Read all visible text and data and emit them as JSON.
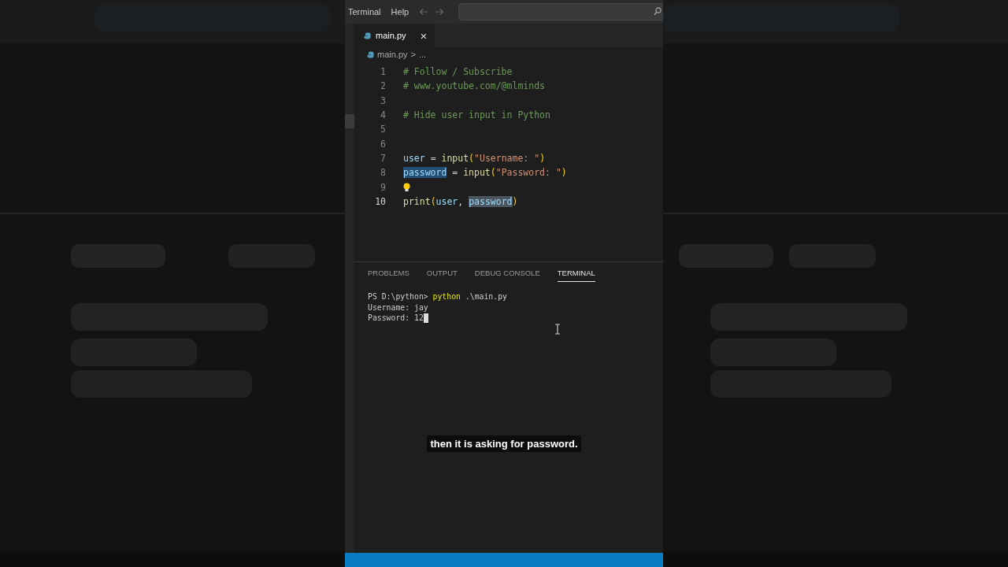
{
  "menu": [
    {
      "label": "Terminal"
    },
    {
      "label": "Help"
    }
  ],
  "editor_tabs": [
    {
      "label": "main.py",
      "selected": true,
      "close": "×"
    }
  ],
  "breadcrumb": {
    "file": "main.py",
    "separator": ">",
    "rest": "..."
  },
  "code_lines": [
    {
      "number": "1",
      "current": false,
      "tokens": [
        {
          "text": "# Follow / Subscribe",
          "kind": "comment"
        }
      ]
    },
    {
      "number": "2",
      "current": false,
      "tokens": [
        {
          "text": "# www.youtube.com/@mlminds",
          "kind": "comment"
        }
      ]
    },
    {
      "number": "3",
      "current": false
    },
    {
      "number": "4",
      "current": false,
      "tokens": [
        {
          "text": "# Hide user input in Python",
          "kind": "comment"
        }
      ]
    },
    {
      "number": "5",
      "current": false
    },
    {
      "number": "6",
      "current": false
    },
    {
      "number": "7",
      "current": false,
      "tokens": [
        {
          "text": "user",
          "kind": "var"
        },
        {
          "text": " = ",
          "kind": "plain"
        },
        {
          "text": "input",
          "kind": "func"
        },
        {
          "text": "(",
          "kind": "paren"
        },
        {
          "text": "\"Username: \"",
          "kind": "string"
        },
        {
          "text": ")",
          "kind": "paren"
        }
      ]
    },
    {
      "number": "8",
      "current": false,
      "tokens": [
        {
          "text": "password",
          "kind": "var",
          "selected": true
        },
        {
          "text": " = ",
          "kind": "plain"
        },
        {
          "text": "input",
          "kind": "func"
        },
        {
          "text": "(",
          "kind": "paren"
        },
        {
          "text": "\"Password: \"",
          "kind": "string"
        },
        {
          "text": ")",
          "kind": "paren"
        }
      ]
    },
    {
      "number": "9",
      "current": false,
      "lightbulb": true
    },
    {
      "number": "10",
      "current": true,
      "tokens": [
        {
          "text": "print",
          "kind": "func"
        },
        {
          "text": "(",
          "kind": "paren"
        },
        {
          "text": "user",
          "kind": "var"
        },
        {
          "text": ", ",
          "kind": "plain"
        },
        {
          "text": "password",
          "kind": "var",
          "match_highlighted": true
        },
        {
          "text": ")",
          "kind": "paren"
        }
      ]
    }
  ],
  "panel_tabs": [
    {
      "label": "PROBLEMS",
      "selected": false
    },
    {
      "label": "OUTPUT",
      "selected": false
    },
    {
      "label": "DEBUG CONSOLE",
      "selected": false
    },
    {
      "label": "TERMINAL",
      "selected": true
    }
  ],
  "terminal_lines": [
    {
      "tokens": [
        {
          "text": "PS D:\\python> ",
          "kind": "plain"
        },
        {
          "text": "python",
          "kind": "command"
        },
        {
          "text": " .\\main.py",
          "kind": "plain"
        }
      ]
    },
    {
      "tokens": [
        {
          "text": "Username: jay",
          "kind": "plain"
        }
      ]
    },
    {
      "tokens": [
        {
          "text": "Password: 12",
          "kind": "plain"
        }
      ],
      "cursor": true
    }
  ],
  "caption": "then it is asking for password."
}
